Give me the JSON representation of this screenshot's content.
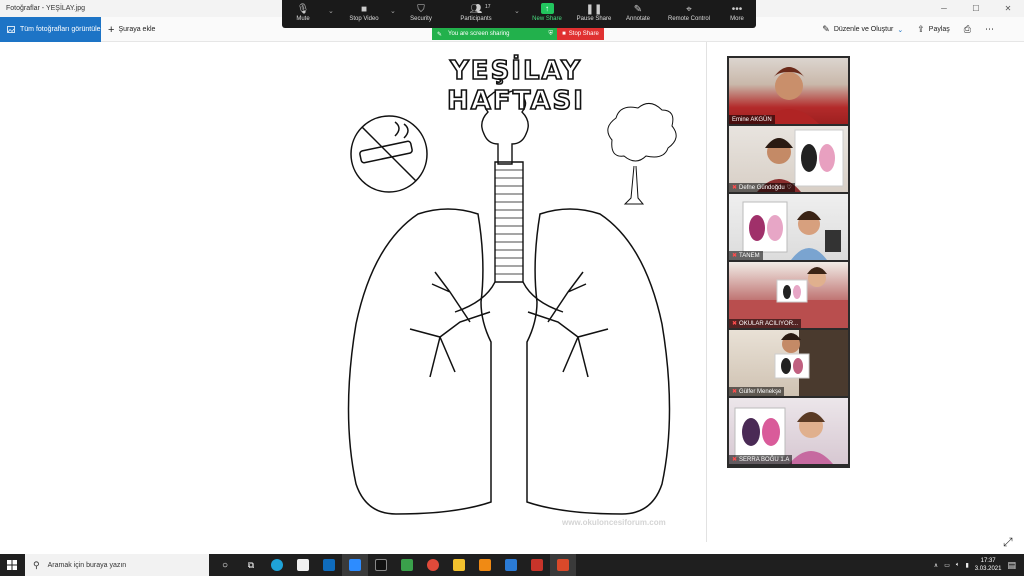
{
  "window": {
    "title": "Fotoğraflar - YEŞİLAY.jpg"
  },
  "photos_toolbar": {
    "all_photos": "Tüm fotoğrafları görüntüle",
    "add_to": "Şuraya ekle",
    "edit_create": "Düzenle ve Oluştur",
    "share": "Paylaş"
  },
  "zoom_toolbar": {
    "mute": "Mute",
    "stop_video": "Stop Video",
    "security": "Security",
    "participants": "Participants",
    "participants_count": "17",
    "new_share": "New Share",
    "pause_share": "Pause Share",
    "annotate": "Annotate",
    "remote_control": "Remote Control",
    "more": "More"
  },
  "share_banner": {
    "status": "You are screen sharing",
    "stop": "Stop Share"
  },
  "poster": {
    "title": "YEŞİLAY HAFTASI",
    "watermark": "www.okuloncesiforum.com"
  },
  "participants": [
    {
      "name": "Emine AKGÜN",
      "muted": false
    },
    {
      "name": "Defne Gündoğdu ♡",
      "muted": true
    },
    {
      "name": "TANEM",
      "muted": true
    },
    {
      "name": "OKULAR ACILIYOR...",
      "muted": true
    },
    {
      "name": "Gülfer Menekşe",
      "muted": true
    },
    {
      "name": "SERRA BOĞU 1.A",
      "muted": true
    }
  ],
  "taskbar": {
    "search_placeholder": "Aramak için buraya yazın",
    "time": "17:37",
    "date": "3.03.2021"
  },
  "colors": {
    "accent_blue": "#1d74c6",
    "share_green": "#22b14c",
    "stop_red": "#e03131",
    "zoom_bar": "#1a1a1a"
  }
}
